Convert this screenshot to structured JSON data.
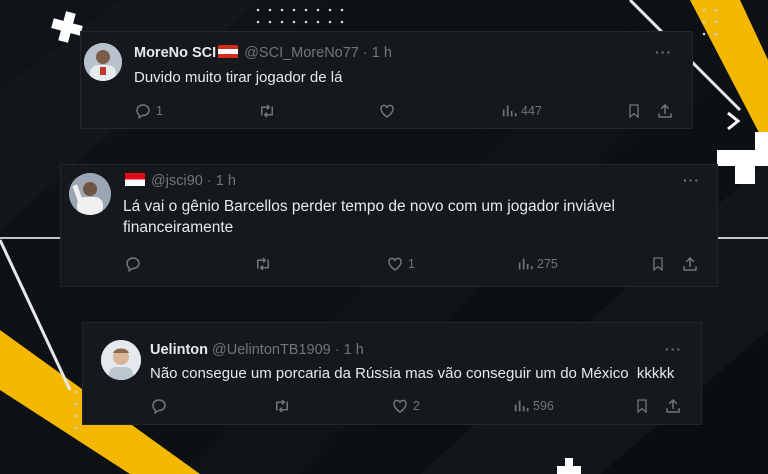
{
  "tweets": [
    {
      "display_name": "MoreNo SCI",
      "handle": "@SCI_MoreNo77",
      "sep": "·",
      "time": "1 h",
      "text": "Duvido muito tirar jogador de lá",
      "reply_count": "1",
      "retweet_count": "",
      "like_count": "",
      "view_count": "447",
      "more": "···"
    },
    {
      "display_name": "",
      "handle": "@jsci90",
      "sep": "·",
      "time": "1 h",
      "text_line1": "Lá vai o gênio Barcellos perder tempo de novo com um jogador inviável",
      "text_line2": "financeiramente",
      "reply_count": "",
      "retweet_count": "",
      "like_count": "1",
      "view_count": "275",
      "more": "···"
    },
    {
      "display_name": "Uelinton",
      "handle": "@UelintonTB1909",
      "sep": "·",
      "time": "1 h",
      "text": "Não consegue um porcaria da Rússia mas vão conseguir um do México  kkkkk",
      "reply_count": "",
      "retweet_count": "",
      "like_count": "2",
      "view_count": "596",
      "more": "···"
    }
  ],
  "colors": {
    "background": "#0d1014",
    "card": "#15181c",
    "accent_yellow": "#f5b800",
    "text_primary": "#e7e9ea",
    "text_secondary": "#71767b"
  },
  "icons": [
    "reply-icon",
    "retweet-icon",
    "like-icon",
    "views-icon",
    "bookmark-icon",
    "share-icon",
    "more-icon",
    "flag-icon"
  ]
}
